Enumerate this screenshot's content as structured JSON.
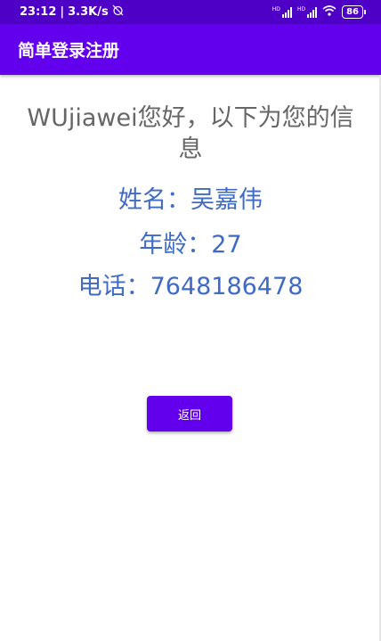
{
  "status_bar": {
    "time": "23:12",
    "separator": "|",
    "net_speed": "3.3K/s",
    "battery": "86",
    "icons": [
      "alarm-off-icon",
      "signal-hd-icon",
      "signal-hd-icon",
      "wifi-icon",
      "battery-icon"
    ]
  },
  "app_bar": {
    "title": "简单登录注册"
  },
  "main": {
    "welcome_text": "WUjiawei您好，以下为您的信息",
    "name_line": "姓名：吴嘉伟",
    "age_line": "年龄：27",
    "phone_line": "电话：7648186478",
    "back_button": "返回"
  },
  "colors": {
    "status_bar": "#4f00c6",
    "app_bar": "#6200ee",
    "info_text": "#3f6bc4",
    "welcome_text": "#666666",
    "button": "#6200ee"
  }
}
